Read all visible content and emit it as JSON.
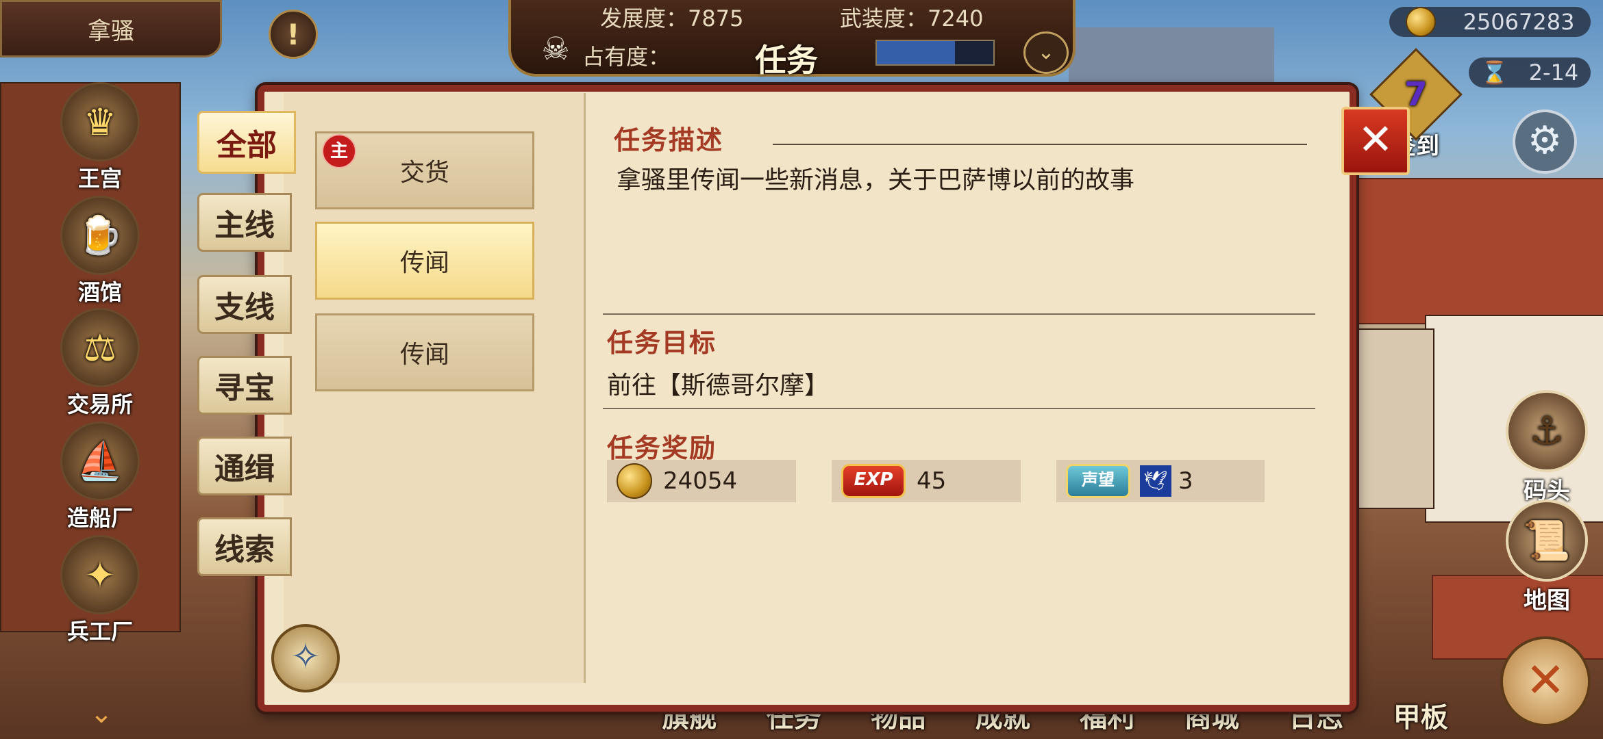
{
  "top": {
    "city": "拿骚",
    "alert_icon": "!",
    "stats": {
      "development_label": "发展度",
      "development_value": "7875",
      "armament_label": "武装度",
      "armament_value": "7240",
      "occupancy_label": "占有度",
      "occupancy_faction": "",
      "occupancy_pct": "",
      "occupancy_fill": 0.67
    },
    "title": "任务",
    "coins": "25067283",
    "date": "2-14"
  },
  "sidebar": {
    "items": [
      {
        "label": "王宫",
        "glyph": "♛"
      },
      {
        "label": "酒馆",
        "glyph": "🍺"
      },
      {
        "label": "交易所",
        "glyph": "⚖"
      },
      {
        "label": "造船厂",
        "glyph": "⛵"
      },
      {
        "label": "兵工厂",
        "glyph": "✦"
      }
    ]
  },
  "right": {
    "signin": "签到",
    "signin_num": "7",
    "dock": "码头",
    "map": "地图"
  },
  "bottom_nav": [
    "旗舰",
    "任务",
    "物品",
    "成就",
    "福利",
    "商城",
    "日志",
    "甲板"
  ],
  "categories": [
    "全部",
    "主线",
    "支线",
    "寻宝",
    "通缉",
    "线索"
  ],
  "quests": [
    {
      "label": "交货",
      "badge": "主"
    },
    {
      "label": "传闻"
    },
    {
      "label": "传闻"
    }
  ],
  "detail": {
    "desc_title": "任务描述",
    "desc_text": "拿骚里传闻一些新消息，关于巴萨博以前的故事",
    "goal_title": "任务目标",
    "goal_text": "前往【斯德哥尔摩】",
    "reward_title": "任务奖励",
    "rewards": {
      "coins": "24054",
      "exp_label": "EXP",
      "exp": "45",
      "rep_label": "声望",
      "rep": "3"
    }
  },
  "colors": {
    "accent_red": "#a53a24",
    "panel_border": "#8a2c22",
    "parchment": "#f1e4c7"
  }
}
